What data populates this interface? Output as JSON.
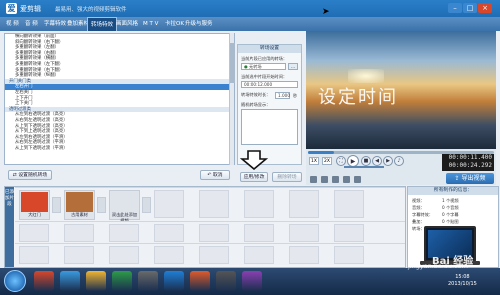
{
  "titlebar": {
    "logo": "爱",
    "title": "爱剪辑",
    "subtitle": "最易用、强大的视频剪辑软件"
  },
  "menu": {
    "items": [
      "视 频",
      "音 频",
      "字幕特效",
      "叠加素材",
      "转场特效",
      "画面风格",
      "M T V",
      "卡拉OK",
      "升级与服务"
    ],
    "active_index": 4
  },
  "effects_list": {
    "rows": [
      {
        "text": "横向翻转效果（前面）",
        "type": "item"
      },
      {
        "text": "斜向翻转效果（右下翻）",
        "type": "item"
      },
      {
        "text": "多重翻转效果（左翻）",
        "type": "item"
      },
      {
        "text": "多重翻转效果（右翻）",
        "type": "item"
      },
      {
        "text": "多重翻转效果（横翻）",
        "type": "item"
      },
      {
        "text": "多重翻转效果（左下翻）",
        "type": "item"
      },
      {
        "text": "多重翻转效果（右下翻）",
        "type": "item"
      },
      {
        "text": "多重翻转效果（纵翻）",
        "type": "item"
      },
      {
        "text": "开门关门类",
        "type": "cat"
      },
      {
        "text": "左右开门",
        "type": "sel"
      },
      {
        "text": "左右关门",
        "type": "item"
      },
      {
        "text": "上下开门",
        "type": "item"
      },
      {
        "text": "上下关门",
        "type": "item"
      },
      {
        "text": "透明过渡类",
        "type": "cat"
      },
      {
        "text": "从左到右透明过渡（高亮）",
        "type": "item"
      },
      {
        "text": "从右到左透明过渡（高亮）",
        "type": "item"
      },
      {
        "text": "从上到下透明过渡（高亮）",
        "type": "item"
      },
      {
        "text": "从下到上透明过渡（高亮）",
        "type": "item"
      },
      {
        "text": "从左到右透明过渡（平滑）",
        "type": "item"
      },
      {
        "text": "从右到左透明过渡（平滑）",
        "type": "item"
      },
      {
        "text": "从上到下透明过渡（平滑）",
        "type": "item"
      }
    ]
  },
  "properties": {
    "title": "转场设置",
    "label_current_transition": "当前片段已应用的转场：",
    "current_transition_value": "无转场",
    "label_start_time": "当前选中片段开始时间：",
    "start_time_value": "00:00:12.000",
    "label_duration": "转场特效时长：",
    "duration_value": "1.000",
    "label_unit": "秒",
    "label_loop": "随机转场显示：",
    "browse_label": "..."
  },
  "left_buttons": {
    "settings": "设置随机转场",
    "cancel": "取消",
    "apply": "应用/修改",
    "delete": "删除转场"
  },
  "preview": {
    "overlay_text": "设定时间",
    "time_current": "00:00:11.400",
    "time_total": "00:00:24.292",
    "speed_1": "1X",
    "speed_2": "2X",
    "export_label": "导出视频",
    "seek_fraction": 0.14
  },
  "timeline": {
    "header": "已添加片段",
    "clips": [
      {
        "label": "大红门",
        "color": "#d9472b"
      },
      {
        "label": "古用素材",
        "color": "#b36e3a"
      },
      {
        "label": "双击此处添加视频",
        "color": "#dfe4ea"
      }
    ],
    "track_rows": 3
  },
  "right_panel": {
    "title": "所有制作的信息：",
    "rows": [
      {
        "k": "视频：",
        "v": "1 个视频"
      },
      {
        "k": "音频：",
        "v": "0 个音频"
      },
      {
        "k": "字幕特效：",
        "v": "0 个字幕"
      },
      {
        "k": "叠加：",
        "v": "0 个贴图"
      },
      {
        "k": "转场：",
        "v": "1 个转场"
      }
    ]
  },
  "watermark": {
    "line1": "Bai 经验",
    "line2": "jingyan.baidu.com"
  },
  "taskbar": {
    "clock": "15:08",
    "date": "2013/10/15",
    "num_icons": 9
  }
}
